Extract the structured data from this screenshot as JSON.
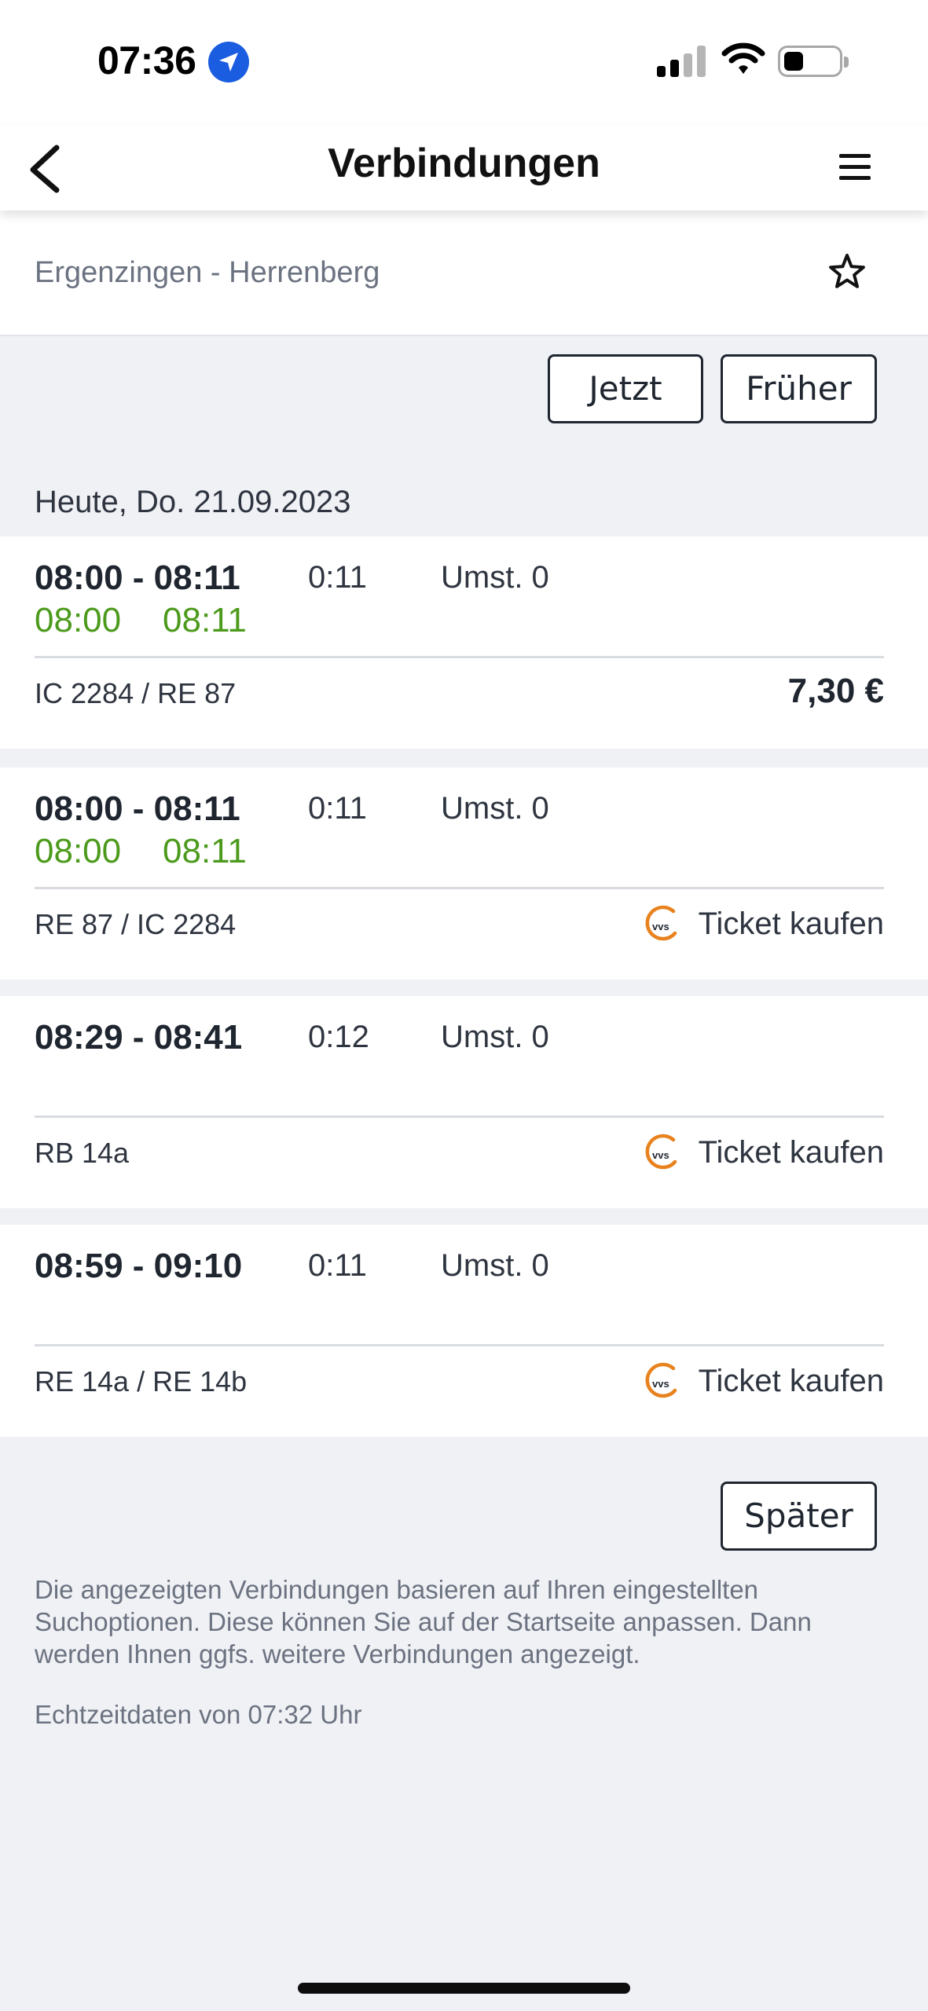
{
  "status_bar": {
    "time": "07:36",
    "icons": [
      "location-arrow-icon",
      "signal-icon",
      "wifi-icon",
      "battery-icon"
    ]
  },
  "nav": {
    "title": "Verbindungen",
    "back_icon": "chevron-left-icon",
    "menu_icon": "hamburger-menu-icon"
  },
  "route": {
    "text": "Ergenzingen - Herrenberg",
    "favorite_icon": "star-outline-icon"
  },
  "buttons": {
    "now": "Jetzt",
    "earlier": "Früher",
    "later": "Später"
  },
  "date_heading": "Heute, Do. 21.09.2023",
  "connections": [
    {
      "times": "08:00 - 08:11",
      "duration": "0:11",
      "transfers": "Umst. 0",
      "rt_dep": "08:00",
      "rt_arr": "08:11",
      "lines": "IC 2284 / RE 87",
      "price": "7,30 €"
    },
    {
      "times": "08:00 - 08:11",
      "duration": "0:11",
      "transfers": "Umst. 0",
      "rt_dep": "08:00",
      "rt_arr": "08:11",
      "lines": "RE 87 / IC 2284",
      "ticket": "Ticket kaufen"
    },
    {
      "times": "08:29 - 08:41",
      "duration": "0:12",
      "transfers": "Umst. 0",
      "lines": "RB 14a",
      "ticket": "Ticket kaufen"
    },
    {
      "times": "08:59 - 09:10",
      "duration": "0:11",
      "transfers": "Umst. 0",
      "lines": "RE 14a / RE 14b",
      "ticket": "Ticket kaufen"
    }
  ],
  "vvs_logo_text": "vvs",
  "footer": {
    "note": "Die angezeigten Verbindungen basieren auf Ihren eingestellten Suchoptionen. Diese können Sie auf der Startseite anpassen. Dann werden Ihnen ggfs. weitere Verbindungen angezeigt.",
    "realtime": "Echtzeitdaten von 07:32 Uhr"
  },
  "colors": {
    "realtime_green": "#4c9a1c",
    "vvs_orange": "#e8821e",
    "background": "#f0f1f5",
    "text": "#1f2630"
  }
}
